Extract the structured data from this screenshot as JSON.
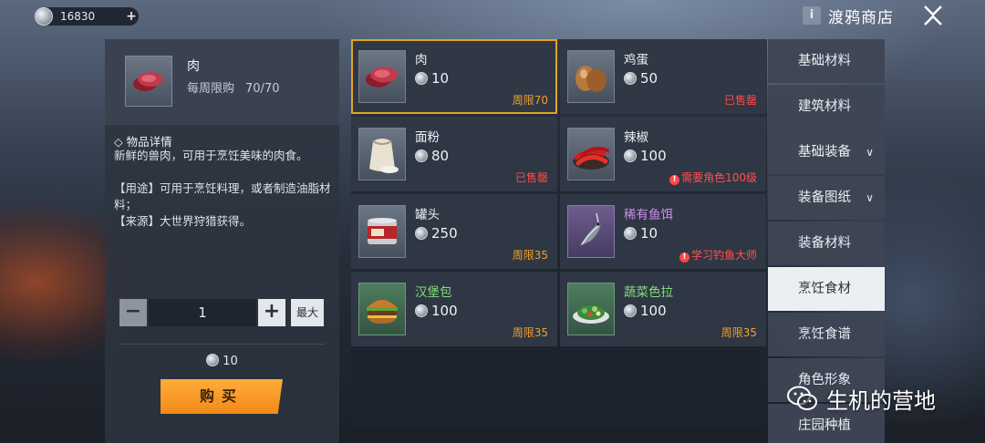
{
  "currency": {
    "amount": "16830",
    "plus": "+"
  },
  "header": {
    "info": "i",
    "title": "渡鸦商店"
  },
  "detail": {
    "name": "肉",
    "limit_label": "每周限购",
    "limit_value": "70/70",
    "section_title": "◇ 物品详情",
    "desc_1": "新鲜的兽肉，可用于烹饪美味的肉食。",
    "desc_2": "【用途】可用于烹饪料理，或者制造油脂材料；",
    "desc_3": "【来源】大世界狩猎获得。",
    "quantity": "1",
    "minus": "−",
    "plus": "+",
    "max": "最大",
    "total": "10",
    "buy": "购买"
  },
  "items": [
    {
      "name": "肉",
      "price": "10",
      "status": "周限70"
    },
    {
      "name": "鸡蛋",
      "price": "50",
      "status": "已售罄"
    },
    {
      "name": "面粉",
      "price": "80",
      "status": "已售罄"
    },
    {
      "name": "辣椒",
      "price": "100",
      "status": "需要角色100级"
    },
    {
      "name": "罐头",
      "price": "250",
      "status": "周限35"
    },
    {
      "name": "稀有鱼饵",
      "price": "10",
      "status": "学习钓鱼大师"
    },
    {
      "name": "汉堡包",
      "price": "100",
      "status": "周限35"
    },
    {
      "name": "蔬菜色拉",
      "price": "100",
      "status": "周限35"
    }
  ],
  "categories": [
    "基础材料",
    "建筑材料",
    "基础装备",
    "装备图纸",
    "装备材料",
    "烹饪食材",
    "烹饪食谱",
    "角色形象",
    "庄园种植"
  ],
  "watermark": "生机的营地",
  "colors": {
    "accent_orange": "#f28a17",
    "limit_orange": "#f0a12a",
    "sold_red": "#ff4a4a",
    "rare_green": "#86e07a",
    "rare_purple": "#d28cf0"
  }
}
